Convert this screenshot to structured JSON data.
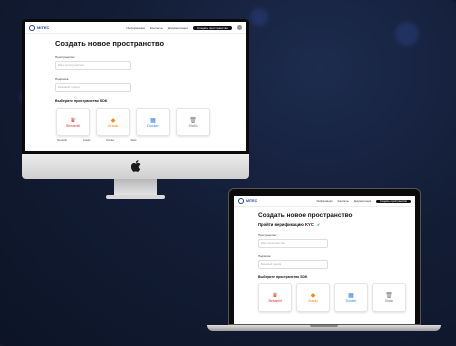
{
  "app": {
    "logo": "MITEC",
    "nav": [
      "Информация",
      "Контакты",
      "Документация"
    ],
    "nav_button": "Создать пространство"
  },
  "page": {
    "title": "Создать новое пространство",
    "kyc_message": "Пройти верификацию KYC",
    "field_space_label": "Пространство",
    "field_space_placeholder": "Имя пространства",
    "field_plan_label": "Подписка",
    "field_plan_placeholder": "Базовый тариф",
    "section_label": "Выберите пространство SDK"
  },
  "sdk_cards": [
    {
      "name": "Streamlit",
      "icon": "streamlit-icon",
      "color": "#d9302c",
      "glyph": "♛"
    },
    {
      "name": "Gradio",
      "icon": "gradio-icon",
      "color": "#f08a1d",
      "glyph": "◆"
    },
    {
      "name": "Docker",
      "icon": "docker-icon",
      "color": "#2a7fd4",
      "glyph": "▦"
    },
    {
      "name": "Static",
      "icon": "trash-icon",
      "color": "#777777",
      "glyph": "🗑"
    }
  ],
  "below_cards": [
    "Streamlit",
    "Gradio",
    "Docker",
    "Static"
  ],
  "apple_logo": ""
}
